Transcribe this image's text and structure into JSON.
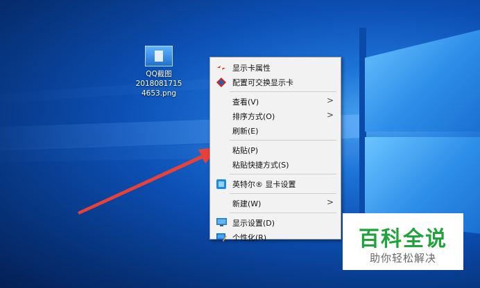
{
  "desktop": {
    "icon": {
      "label_lines": [
        "QQ截图",
        "2018081715",
        "4653.png"
      ]
    }
  },
  "context_menu": {
    "groups": [
      [
        {
          "label": "显示卡属性",
          "icon": "graphics-properties-icon"
        },
        {
          "label": "配置可交换显示卡",
          "icon": "switchable-graphics-icon"
        }
      ],
      [
        {
          "label": "查看(V)",
          "submenu": true
        },
        {
          "label": "排序方式(O)",
          "submenu": true
        },
        {
          "label": "刷新(E)"
        }
      ],
      [
        {
          "label": "粘贴(P)"
        },
        {
          "label": "粘贴快捷方式(S)"
        }
      ],
      [
        {
          "label": "英特尔® 显卡设置",
          "icon": "intel-graphics-icon"
        }
      ],
      [
        {
          "label": "新建(W)",
          "submenu": true
        }
      ],
      [
        {
          "label": "显示设置(D)",
          "icon": "display-settings-icon"
        },
        {
          "label": "个性化(R)",
          "icon": "personalize-icon"
        }
      ]
    ],
    "submenu_glyph": ">"
  },
  "watermark": {
    "title": "百科全说",
    "subtitle": "助你轻松解决"
  },
  "colors": {
    "arrow": "#e8413a",
    "watermark_green": "#1fa33a",
    "menu_bg": "#f2f2f2"
  }
}
